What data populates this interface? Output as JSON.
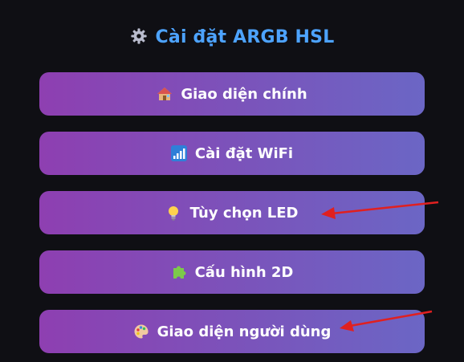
{
  "header": {
    "title": "Cài đặt ARGB HSL",
    "icon": "gear-icon"
  },
  "menu": {
    "items": [
      {
        "label": "Giao diện chính",
        "icon": "house-icon"
      },
      {
        "label": "Cài đặt WiFi",
        "icon": "signal-bars-icon"
      },
      {
        "label": "Tùy chọn LED",
        "icon": "light-bulb-icon"
      },
      {
        "label": "Cấu hình 2D",
        "icon": "puzzle-piece-icon"
      },
      {
        "label": "Giao diện người dùng",
        "icon": "palette-icon"
      }
    ]
  },
  "colors": {
    "background": "#0f0f14",
    "title": "#4da3ff",
    "button_gradient_start": "#8e3fb1",
    "button_gradient_end": "#6b66c5",
    "annotation_arrow": "#e02020"
  }
}
